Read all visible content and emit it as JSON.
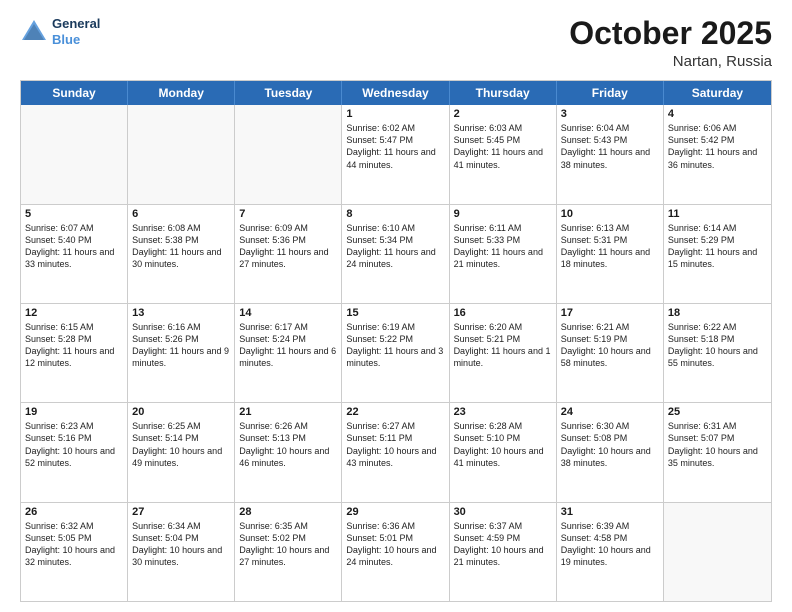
{
  "header": {
    "logo_line1": "General",
    "logo_line2": "Blue",
    "month": "October 2025",
    "location": "Nartan, Russia"
  },
  "days_of_week": [
    "Sunday",
    "Monday",
    "Tuesday",
    "Wednesday",
    "Thursday",
    "Friday",
    "Saturday"
  ],
  "weeks": [
    [
      {
        "day": "",
        "info": ""
      },
      {
        "day": "",
        "info": ""
      },
      {
        "day": "",
        "info": ""
      },
      {
        "day": "1",
        "info": "Sunrise: 6:02 AM\nSunset: 5:47 PM\nDaylight: 11 hours and 44 minutes."
      },
      {
        "day": "2",
        "info": "Sunrise: 6:03 AM\nSunset: 5:45 PM\nDaylight: 11 hours and 41 minutes."
      },
      {
        "day": "3",
        "info": "Sunrise: 6:04 AM\nSunset: 5:43 PM\nDaylight: 11 hours and 38 minutes."
      },
      {
        "day": "4",
        "info": "Sunrise: 6:06 AM\nSunset: 5:42 PM\nDaylight: 11 hours and 36 minutes."
      }
    ],
    [
      {
        "day": "5",
        "info": "Sunrise: 6:07 AM\nSunset: 5:40 PM\nDaylight: 11 hours and 33 minutes."
      },
      {
        "day": "6",
        "info": "Sunrise: 6:08 AM\nSunset: 5:38 PM\nDaylight: 11 hours and 30 minutes."
      },
      {
        "day": "7",
        "info": "Sunrise: 6:09 AM\nSunset: 5:36 PM\nDaylight: 11 hours and 27 minutes."
      },
      {
        "day": "8",
        "info": "Sunrise: 6:10 AM\nSunset: 5:34 PM\nDaylight: 11 hours and 24 minutes."
      },
      {
        "day": "9",
        "info": "Sunrise: 6:11 AM\nSunset: 5:33 PM\nDaylight: 11 hours and 21 minutes."
      },
      {
        "day": "10",
        "info": "Sunrise: 6:13 AM\nSunset: 5:31 PM\nDaylight: 11 hours and 18 minutes."
      },
      {
        "day": "11",
        "info": "Sunrise: 6:14 AM\nSunset: 5:29 PM\nDaylight: 11 hours and 15 minutes."
      }
    ],
    [
      {
        "day": "12",
        "info": "Sunrise: 6:15 AM\nSunset: 5:28 PM\nDaylight: 11 hours and 12 minutes."
      },
      {
        "day": "13",
        "info": "Sunrise: 6:16 AM\nSunset: 5:26 PM\nDaylight: 11 hours and 9 minutes."
      },
      {
        "day": "14",
        "info": "Sunrise: 6:17 AM\nSunset: 5:24 PM\nDaylight: 11 hours and 6 minutes."
      },
      {
        "day": "15",
        "info": "Sunrise: 6:19 AM\nSunset: 5:22 PM\nDaylight: 11 hours and 3 minutes."
      },
      {
        "day": "16",
        "info": "Sunrise: 6:20 AM\nSunset: 5:21 PM\nDaylight: 11 hours and 1 minute."
      },
      {
        "day": "17",
        "info": "Sunrise: 6:21 AM\nSunset: 5:19 PM\nDaylight: 10 hours and 58 minutes."
      },
      {
        "day": "18",
        "info": "Sunrise: 6:22 AM\nSunset: 5:18 PM\nDaylight: 10 hours and 55 minutes."
      }
    ],
    [
      {
        "day": "19",
        "info": "Sunrise: 6:23 AM\nSunset: 5:16 PM\nDaylight: 10 hours and 52 minutes."
      },
      {
        "day": "20",
        "info": "Sunrise: 6:25 AM\nSunset: 5:14 PM\nDaylight: 10 hours and 49 minutes."
      },
      {
        "day": "21",
        "info": "Sunrise: 6:26 AM\nSunset: 5:13 PM\nDaylight: 10 hours and 46 minutes."
      },
      {
        "day": "22",
        "info": "Sunrise: 6:27 AM\nSunset: 5:11 PM\nDaylight: 10 hours and 43 minutes."
      },
      {
        "day": "23",
        "info": "Sunrise: 6:28 AM\nSunset: 5:10 PM\nDaylight: 10 hours and 41 minutes."
      },
      {
        "day": "24",
        "info": "Sunrise: 6:30 AM\nSunset: 5:08 PM\nDaylight: 10 hours and 38 minutes."
      },
      {
        "day": "25",
        "info": "Sunrise: 6:31 AM\nSunset: 5:07 PM\nDaylight: 10 hours and 35 minutes."
      }
    ],
    [
      {
        "day": "26",
        "info": "Sunrise: 6:32 AM\nSunset: 5:05 PM\nDaylight: 10 hours and 32 minutes."
      },
      {
        "day": "27",
        "info": "Sunrise: 6:34 AM\nSunset: 5:04 PM\nDaylight: 10 hours and 30 minutes."
      },
      {
        "day": "28",
        "info": "Sunrise: 6:35 AM\nSunset: 5:02 PM\nDaylight: 10 hours and 27 minutes."
      },
      {
        "day": "29",
        "info": "Sunrise: 6:36 AM\nSunset: 5:01 PM\nDaylight: 10 hours and 24 minutes."
      },
      {
        "day": "30",
        "info": "Sunrise: 6:37 AM\nSunset: 4:59 PM\nDaylight: 10 hours and 21 minutes."
      },
      {
        "day": "31",
        "info": "Sunrise: 6:39 AM\nSunset: 4:58 PM\nDaylight: 10 hours and 19 minutes."
      },
      {
        "day": "",
        "info": ""
      }
    ]
  ]
}
